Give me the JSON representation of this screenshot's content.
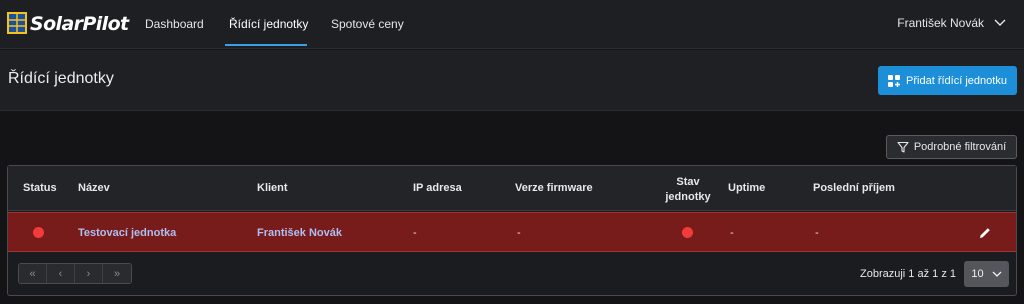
{
  "app": {
    "logo_text": "SolarPilot"
  },
  "nav": {
    "items": [
      {
        "label": "Dashboard"
      },
      {
        "label": "Řídící jednotky"
      },
      {
        "label": "Spotové ceny"
      }
    ],
    "active_index": 1
  },
  "user": {
    "name": "František Novák",
    "icon": "chevron-down-icon"
  },
  "header": {
    "title": "Řídící jednotky",
    "add_button": {
      "label": "Přidat řídící jednotku",
      "icon": "add-widget-icon"
    }
  },
  "filter": {
    "label": "Podrobné filtrování",
    "icon": "funnel-icon"
  },
  "table": {
    "columns": [
      "Status",
      "Název",
      "Klient",
      "IP adresa",
      "Verze firmware",
      "Stav jednotky",
      "Uptime",
      "Poslední příjem"
    ],
    "rows": [
      {
        "status": "offline",
        "name": "Testovací jednotka",
        "client": "František Novák",
        "ip": "-",
        "firmware": "-",
        "unit_state": "offline",
        "uptime": "-",
        "last_received": "-"
      }
    ]
  },
  "pagination": {
    "buttons": [
      "«",
      "‹",
      "›",
      "»"
    ],
    "info": "Zobrazuji 1 až 1 z 1",
    "page_size": "10"
  },
  "colors": {
    "accent": "#1c8fd8",
    "row_error": "#781b1b",
    "status_red": "#f23b3b",
    "link": "#aebff0"
  }
}
